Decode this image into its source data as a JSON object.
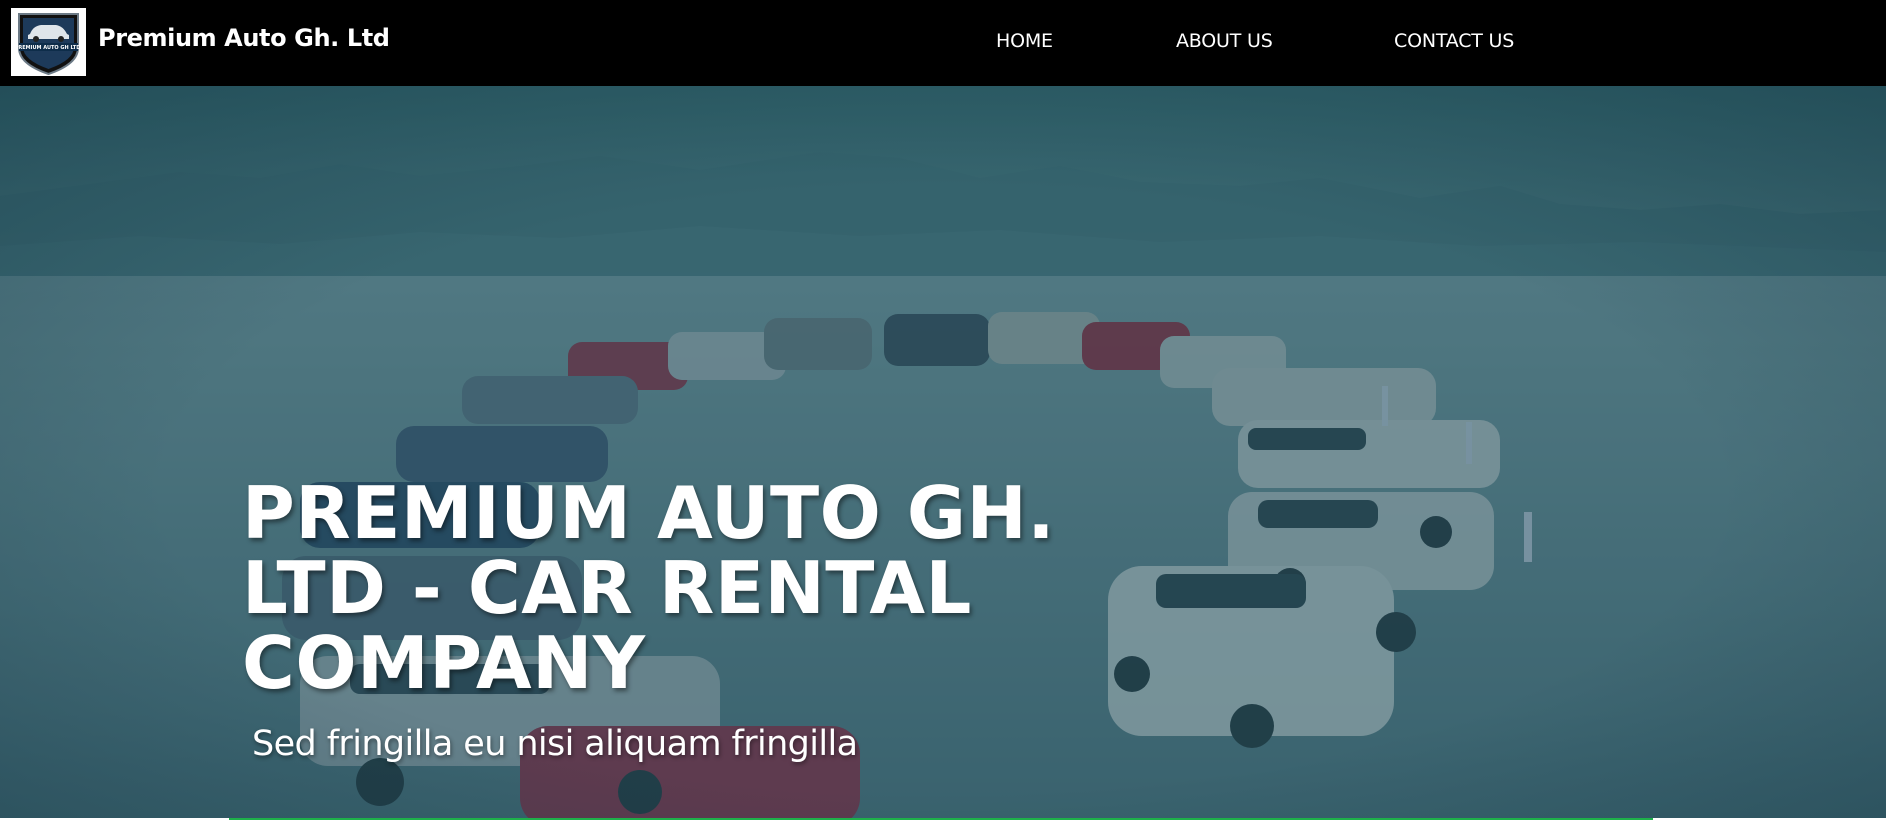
{
  "brand": {
    "name": "Premium Auto Gh. Ltd",
    "logo_text": "PREMIUM AUTO GH LTD.",
    "logo_icon": "car-shield-logo"
  },
  "nav": {
    "items": [
      {
        "label": "HOME"
      },
      {
        "label": "ABOUT US"
      },
      {
        "label": "CONTACT US"
      }
    ]
  },
  "hero": {
    "title": "PREMIUM AUTO GH. LTD - CAR RENTAL COMPANY",
    "subtitle": "Sed fringilla eu nisi aliquam fringilla",
    "background_image": "fleet-of-cars-in-desert-photo"
  },
  "colors": {
    "navbar_bg": "#000000",
    "nav_text": "#ffffff",
    "hero_overlay": "#2a5060",
    "accent_line": "#1eb04a",
    "logo_shield": "#1d3a5a"
  }
}
